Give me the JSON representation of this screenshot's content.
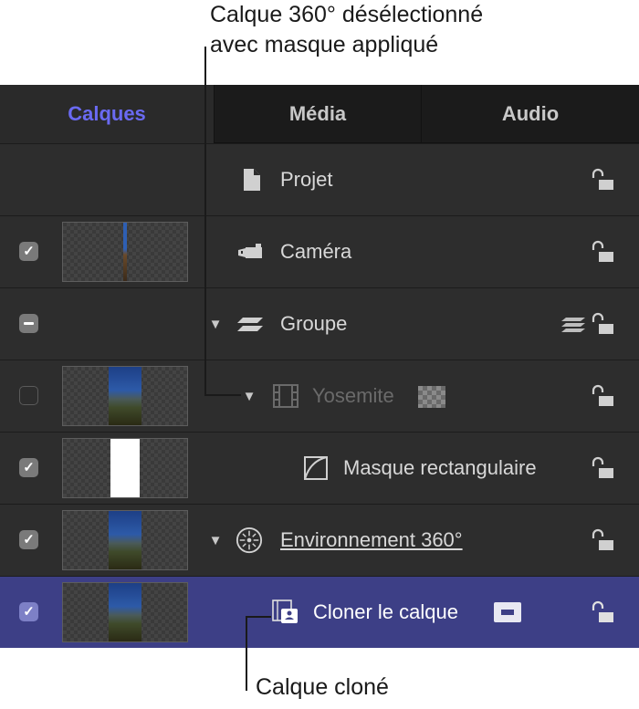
{
  "callouts": {
    "top_line1": "Calque 360° désélectionné",
    "top_line2": "avec masque appliqué",
    "bottom": "Calque cloné"
  },
  "tabs": [
    {
      "label": "Calques",
      "active": true
    },
    {
      "label": "Média",
      "active": false
    },
    {
      "label": "Audio",
      "active": false
    }
  ],
  "layers": [
    {
      "label": "Projet",
      "icon": "document-icon",
      "checkbox": "none",
      "thumbnail": "none",
      "disclosure": false
    },
    {
      "label": "Caméra",
      "icon": "camera-icon",
      "checkbox": "checked",
      "thumbnail": "pole",
      "disclosure": false
    },
    {
      "label": "Groupe",
      "icon": "group-icon",
      "checkbox": "mixed",
      "thumbnail": "none",
      "disclosure": true
    },
    {
      "label": "Yosemite",
      "icon": "film-icon",
      "checkbox": "unchecked",
      "thumbnail": "photo",
      "disclosure": true,
      "dimmed": true
    },
    {
      "label": "Masque rectangulaire",
      "icon": "mask-icon",
      "checkbox": "checked",
      "thumbnail": "white",
      "disclosure": false
    },
    {
      "label": "Environnement 360°",
      "icon": "environment-360-icon",
      "checkbox": "checked",
      "thumbnail": "photo",
      "disclosure": true,
      "underline": true
    },
    {
      "label": "Cloner le calque",
      "icon": "clone-layer-icon",
      "checkbox": "checked",
      "thumbnail": "photo",
      "disclosure": false,
      "selected": true
    }
  ],
  "colors": {
    "active_tab": "#6a6af2",
    "selected_row": "#3d3f86",
    "panel_bg": "#2d2d2d"
  }
}
